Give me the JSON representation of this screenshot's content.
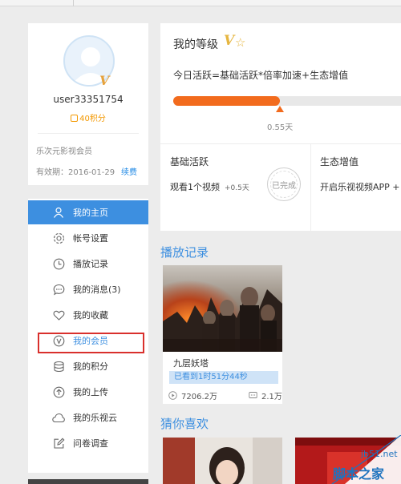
{
  "profile": {
    "username": "user33351754",
    "points": "40积分",
    "member_type": "乐次元影视会员",
    "expiry": "有效期：2016-01-29",
    "renew": "续费",
    "vip_badge": "V"
  },
  "nav": {
    "items": [
      {
        "label": "我的主页",
        "icon": "person-icon",
        "active": true
      },
      {
        "label": "帐号设置",
        "icon": "gear-icon"
      },
      {
        "label": "播放记录",
        "icon": "clock-icon"
      },
      {
        "label": "我的消息(3)",
        "icon": "message-icon"
      },
      {
        "label": "我的收藏",
        "icon": "heart-icon"
      },
      {
        "label": "我的会员",
        "icon": "vip-icon",
        "highlighted": true
      },
      {
        "label": "我的积分",
        "icon": "coins-icon"
      },
      {
        "label": "我的上传",
        "icon": "upload-icon"
      },
      {
        "label": "我的乐视云",
        "icon": "cloud-icon"
      },
      {
        "label": "问卷调查",
        "icon": "edit-icon"
      }
    ]
  },
  "level": {
    "title": "我的等级",
    "badge": "V",
    "formula": "今日活跃=基础活跃*倍率加速+生态增值",
    "progress_value": "0.55天",
    "progress_fraction": 0.47
  },
  "activity": {
    "basic_title": "基础活跃",
    "basic_desc": "观看1个视频",
    "basic_bonus": "+0.5天",
    "done_stamp": "已完成",
    "eco_title": "生态增值",
    "eco_desc": "开启乐视视频APP +"
  },
  "history": {
    "section_title": "播放记录",
    "items": [
      {
        "title": "九层妖塔",
        "watched": "已看到1时51分44秒",
        "views": "7206.2万",
        "comments": "2.1万"
      }
    ]
  },
  "guess": {
    "section_title": "猜你喜欢"
  },
  "watermark": {
    "domain": "jb51.net",
    "title": "脚本之家"
  },
  "colors": {
    "accent": "#3d8fe0",
    "orange": "#f26b1d",
    "highlight_border": "#d9302c",
    "points": "#f39800"
  }
}
